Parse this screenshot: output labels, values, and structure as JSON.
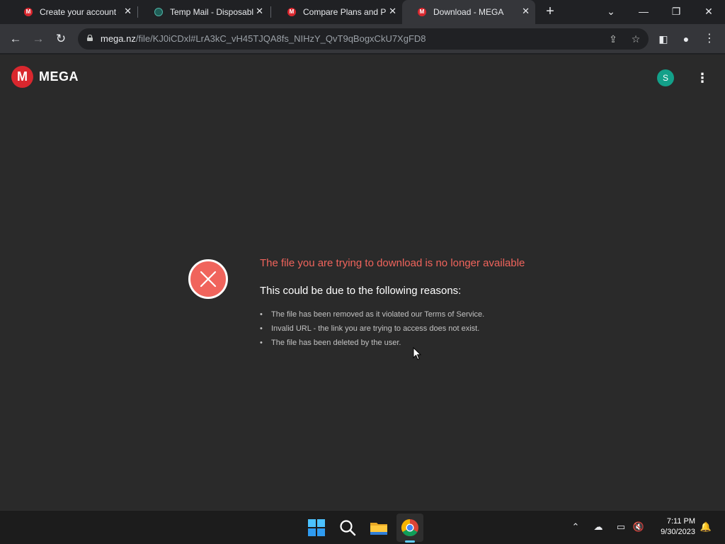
{
  "browser": {
    "tabs": [
      {
        "title": "Create your account -",
        "icon": "mega-favicon"
      },
      {
        "title": "Temp Mail - Disposabl",
        "icon": "tempmail-favicon"
      },
      {
        "title": "Compare Plans and Pr",
        "icon": "mega-favicon"
      },
      {
        "title": "Download - MEGA",
        "icon": "mega-favicon",
        "active": true
      }
    ],
    "new_tab_label": "+",
    "url_host": "mega.nz",
    "url_path": "/file/KJ0iCDxl#LrA3kC_vH45TJQA8fs_NIHzY_QvT9qBogxCkU7XgFD8"
  },
  "page": {
    "logo_mark": "M",
    "logo_text": "MEGA",
    "avatar_initial": "S",
    "error_title": "The file you are trying to download is no longer available",
    "error_subtitle": "This could be due to the following reasons:",
    "reasons": [
      "The file has been removed as it violated our Terms of Service.",
      "Invalid URL - the link you are trying to access does not exist.",
      "The file has been deleted by the user."
    ]
  },
  "taskbar": {
    "time": "7:11 PM",
    "date": "9/30/2023"
  },
  "colors": {
    "mega_red": "#d9272e",
    "error_red": "#f0645c",
    "avatar_teal": "#13a089",
    "page_bg": "#2a2a2a"
  }
}
